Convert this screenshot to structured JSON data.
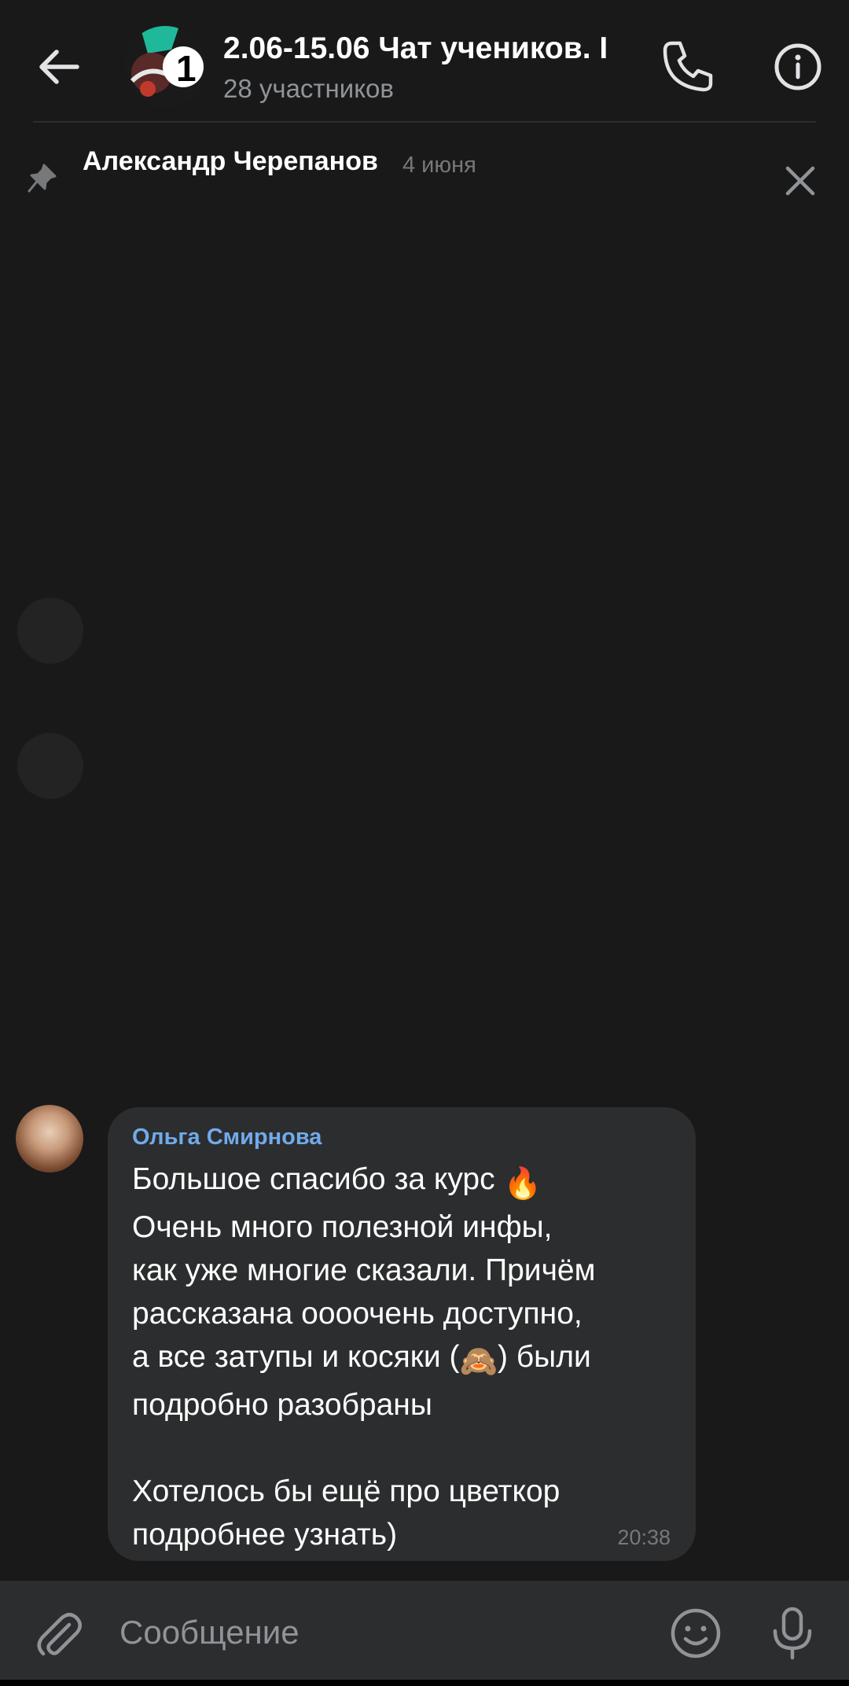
{
  "header": {
    "title": "2.06-15.06 Чат учеников. I",
    "subtitle": "28 участников",
    "avatar_icon": "chat-avatar-icon",
    "back_icon": "arrow-left-icon",
    "call_icon": "phone-icon",
    "info_icon": "info-icon"
  },
  "pinned": {
    "author": "Александр Черепанов",
    "date": "4 июня",
    "pin_icon": "pin-icon",
    "close_icon": "close-icon"
  },
  "message": {
    "sender": "Ольга Смирнова",
    "text_line1": "Большое спасибо за курс ",
    "text_line2": "Очень много полезной инфы,\nкак уже многие сказали. Причём\nрассказана оооочень доступно,\nа все затупы и косяки (",
    "text_line3": ") были\nподробно разобраны\n\nХотелось бы ещё про цветкор\nподробнее узнать)",
    "emoji_fire": "🔥",
    "emoji_monkey": "🙈",
    "time": "20:38"
  },
  "composer": {
    "placeholder": "Сообщение",
    "attach_icon": "paperclip-icon",
    "emoji_icon": "smile-icon",
    "mic_icon": "microphone-icon"
  },
  "colors": {
    "background": "#191919",
    "bubble": "#2c2d2e",
    "sender_name": "#71aaeb",
    "secondary_text": "#909499"
  }
}
